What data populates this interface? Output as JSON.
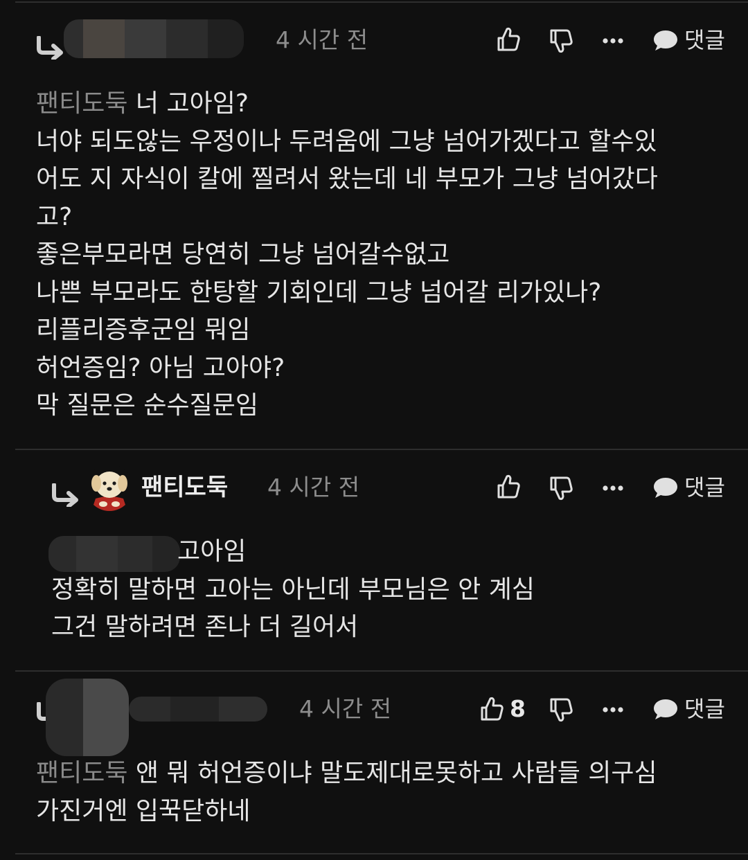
{
  "comments": [
    {
      "time": "4 시간 전",
      "reply_label": "댓글",
      "mention": "팬티도둑",
      "lines": [
        " 너 고아임?",
        "너야 되도않는 우정이나 두려움에 그냥 넘어가겠다고 할수있",
        "어도 지 자식이 칼에 찔려서 왔는데 네 부모가 그냥 넘어갔다",
        "고?",
        "좋은부모라면 당연히 그냥 넘어갈수없고",
        "나쁜 부모라도 한탕할 기회인데 그냥 넘어갈 리가있나?",
        "리플리증후군임 뭐임",
        "허언증임? 아님 고아야?",
        "막 질문은 순수질문임"
      ]
    },
    {
      "username": "팬티도둑",
      "time": "4 시간 전",
      "reply_label": "댓글",
      "lines": [
        "고아임",
        "정확히 말하면 고아는 아닌데 부모님은 안 계심",
        "그건 말하려면 존나 더 길어서"
      ]
    },
    {
      "time": "4 시간 전",
      "like_count": "8",
      "reply_label": "댓글",
      "mention": "팬티도둑",
      "lines": [
        " 앤 뭐 허언증이냐 말도제대로못하고 사람들 의구심",
        "가진거엔 입꾹닫하네"
      ]
    }
  ],
  "icons": {
    "reply_arrow": "reply-arrow-icon",
    "like": "thumbs-up-icon",
    "dislike": "thumbs-down-icon",
    "more": "more-dots-icon",
    "reply": "speech-bubble-icon"
  },
  "colors": {
    "background": "#101010",
    "text": "#e6e6e6",
    "muted": "#8d8d8d",
    "divider": "#2e2e2e"
  }
}
